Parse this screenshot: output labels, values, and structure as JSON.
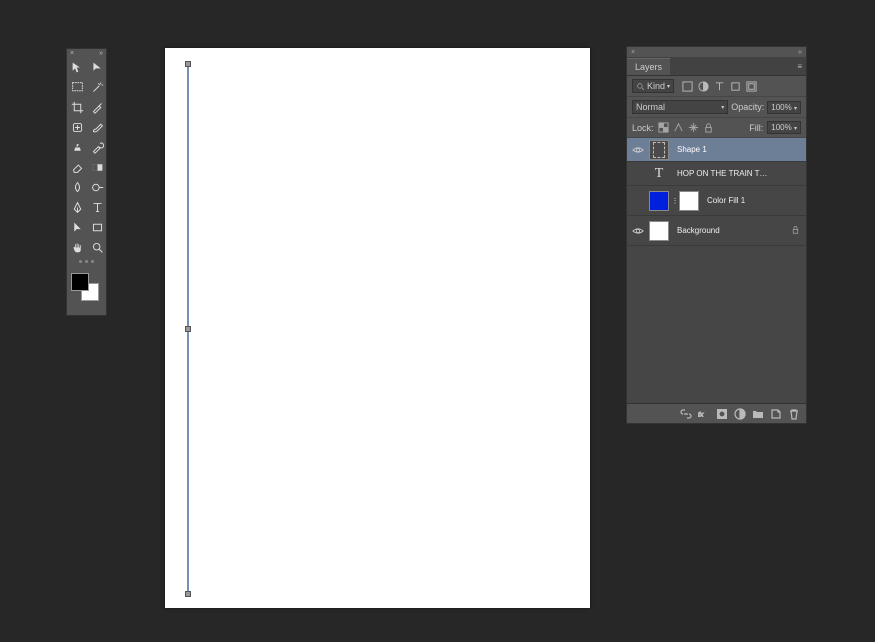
{
  "toolbar": {
    "tools": [
      "move-tool",
      "direct-selection-tool",
      "marquee-tool",
      "magic-wand-tool",
      "crop-tool",
      "eyedropper-tool",
      "healing-brush-tool",
      "brush-tool",
      "clone-stamp-tool",
      "history-brush-tool",
      "eraser-tool",
      "gradient-tool",
      "blur-tool",
      "dodge-tool",
      "pen-tool",
      "type-tool",
      "path-selection-tool",
      "rectangle-tool",
      "hand-tool",
      "zoom-tool"
    ],
    "foreground": "#000000",
    "background": "#ffffff"
  },
  "canvas": {
    "shape": "Shape 1 — vertical line"
  },
  "layers_panel": {
    "title": "Layers",
    "kind_filter": "Kind",
    "blend_mode": "Normal",
    "opacity_label": "Opacity:",
    "opacity_value": "100%",
    "lock_label": "Lock:",
    "fill_label": "Fill:",
    "fill_value": "100%",
    "layers": [
      {
        "name": "Shape 1",
        "type": "shape",
        "selected": true,
        "visible": true
      },
      {
        "name": "HOP ON THE TRAIN TO NOWHERE BABY",
        "type": "text",
        "selected": false,
        "visible": false
      },
      {
        "name": "Color Fill 1",
        "type": "fill",
        "selected": false,
        "visible": false
      },
      {
        "name": "Background",
        "type": "raster",
        "selected": false,
        "visible": true,
        "locked": true
      }
    ],
    "footer_icons": [
      "link",
      "fx",
      "mask",
      "adjust",
      "group",
      "new",
      "delete"
    ]
  }
}
